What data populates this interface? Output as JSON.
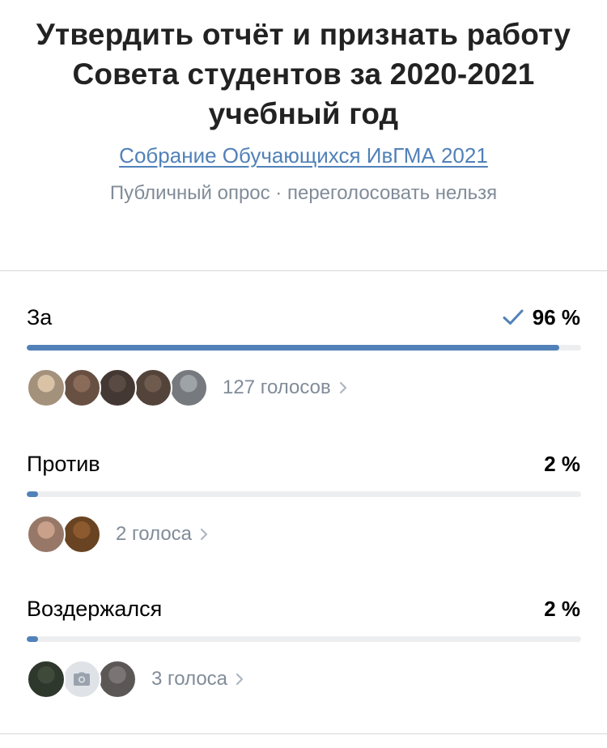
{
  "poll": {
    "title": "Утвердить отчёт и признать работу Совета студентов за 2020-2021 учебный год",
    "community": "Собрание Обучающихся ИвГМА 2021",
    "meta": "Публичный опрос · переголосовать нельзя"
  },
  "options": [
    {
      "label": "За",
      "percent": "96 %",
      "share": 96,
      "selected": true,
      "votes": "127 голосов",
      "avatars": [
        "#d9c2a6",
        "#8a6a58",
        "#5a4a44",
        "#6f5a4e",
        "#9ea3a8"
      ]
    },
    {
      "label": "Против",
      "percent": "2 %",
      "share": 2,
      "selected": false,
      "votes": "2 голоса",
      "avatars": [
        "#c9a08a",
        "#8c5a2e"
      ]
    },
    {
      "label": "Воздержался",
      "percent": "2 %",
      "share": 2,
      "selected": false,
      "votes": "3 голоса",
      "avatars": [
        "#3f4a3a",
        "camera",
        "#7b7474"
      ]
    }
  ],
  "colors": {
    "accent": "#5181b8",
    "secondary_text": "#818c99",
    "track": "#edeef0"
  }
}
